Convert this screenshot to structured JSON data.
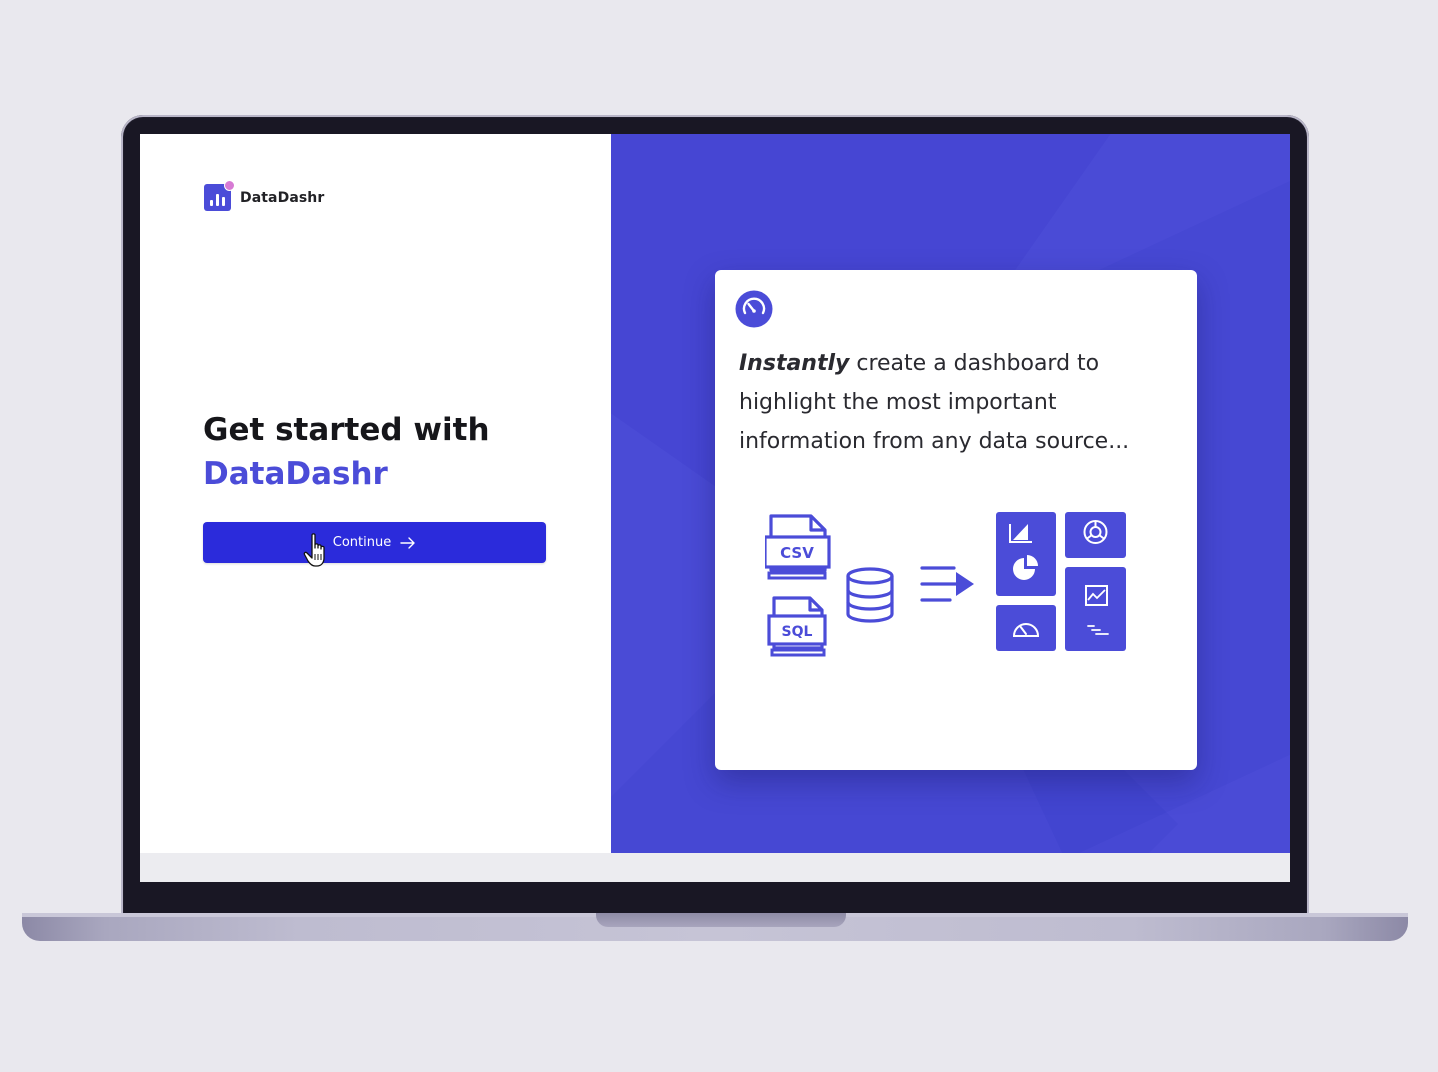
{
  "app": {
    "brand_name": "DataDashr",
    "accent_color": "#4b4cd8",
    "button_color": "#2b2bdb",
    "panel_color": "#4a4bd6"
  },
  "left": {
    "headline_line1": "Get started with",
    "headline_line2": "DataDashr",
    "continue_label": "Continue",
    "continue_icon": "arrow-right-icon"
  },
  "card": {
    "icon": "gauge-icon",
    "text_emphasis": "Instantly",
    "text_rest_line1": " create a dashboard to",
    "text_line2": "highlight the most important",
    "text_line3": "information from any data source...",
    "sources": [
      "CSV",
      "SQL"
    ],
    "source_icons": [
      "csv-file-icon",
      "sql-file-icon",
      "database-icon"
    ],
    "process_icon": "flow-arrow-icon",
    "widget_icons": [
      "area-chart-icon",
      "pie-chart-icon",
      "donut-chart-icon",
      "gauge-icon",
      "line-chart-icon",
      "steps-icon"
    ]
  }
}
